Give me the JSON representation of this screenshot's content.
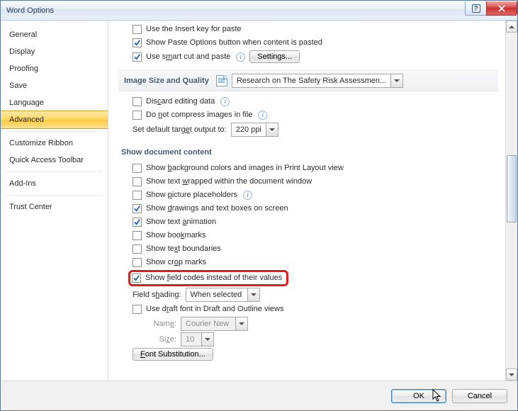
{
  "window": {
    "title": "Word Options"
  },
  "sidebar": {
    "items": [
      {
        "label": "General"
      },
      {
        "label": "Display"
      },
      {
        "label": "Proofing"
      },
      {
        "label": "Save"
      },
      {
        "label": "Language"
      },
      {
        "label": "Advanced",
        "selected": true
      },
      {
        "label": "Customize Ribbon"
      },
      {
        "label": "Quick Access Toolbar"
      },
      {
        "label": "Add-Ins"
      },
      {
        "label": "Trust Center"
      }
    ]
  },
  "opts": {
    "use_insert_key": "Use the Insert key for paste",
    "show_paste_opts": "Show Paste Options button when content is pasted",
    "smart_cut": "Use smart cut and paste",
    "settings_btn": "Settings...",
    "image_section": "Image Size and Quality",
    "image_doc": "Research on The Safety Risk Assessmen...",
    "discard_edit": "Discard editing data",
    "no_compress": "Do not compress images in file",
    "default_target": "Set default target output to:",
    "ppi": "220 ppi",
    "show_doc_section": "Show document content",
    "bg_colors": "Show background colors and images in Print Layout view",
    "text_wrap": "Show text wrapped within the document window",
    "pic_place": "Show picture placeholders",
    "drawings": "Show drawings and text boxes on screen",
    "text_anim": "Show text animation",
    "bookmarks": "Show bookmarks",
    "text_bound": "Show text boundaries",
    "crop_marks": "Show crop marks",
    "field_codes": "Show field codes instead of their values",
    "field_shading_lbl": "Field shading:",
    "field_shading_val": "When selected",
    "draft_font": "Use draft font in Draft and Outline views",
    "name_lbl": "Name:",
    "name_val": "Courier New",
    "size_lbl": "Size:",
    "size_val": "10",
    "font_sub": "Font Substitution..."
  },
  "footer": {
    "ok": "OK",
    "cancel": "Cancel"
  }
}
